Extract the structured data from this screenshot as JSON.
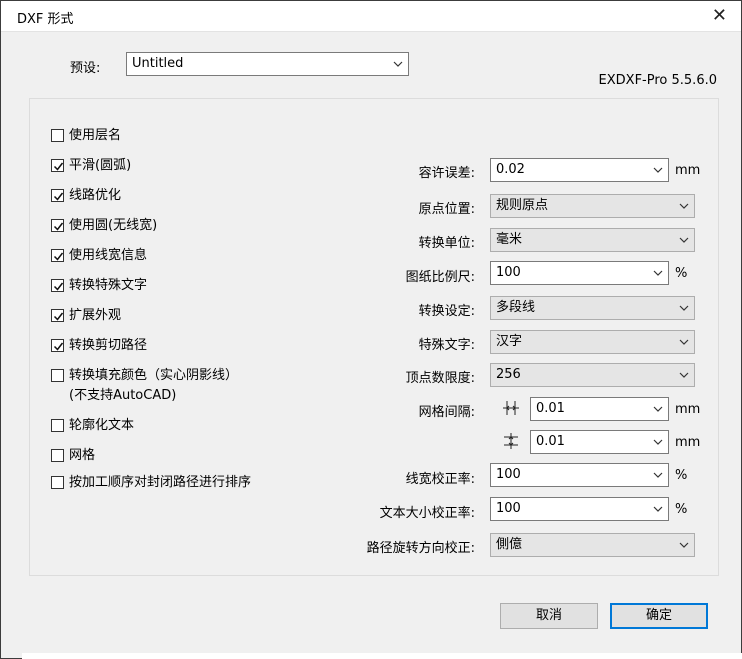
{
  "window": {
    "title": "DXF 形式",
    "close_glyph": "✕"
  },
  "preset": {
    "label": "预设:",
    "value": "Untitled"
  },
  "version": "EXDXF-Pro 5.5.6.0",
  "checkboxes": [
    {
      "label": "使用层名",
      "checked": false
    },
    {
      "label": "平滑(圆弧)",
      "checked": true
    },
    {
      "label": "线路优化",
      "checked": true
    },
    {
      "label": "使用圆(无线宽)",
      "checked": true
    },
    {
      "label": "使用线宽信息",
      "checked": true
    },
    {
      "label": "转换特殊文字",
      "checked": true
    },
    {
      "label": "扩展外观",
      "checked": true
    },
    {
      "label": "转换剪切路径",
      "checked": true
    },
    {
      "label": "转换填充颜色（实心阴影线）",
      "label2": "(不支持AutoCAD)",
      "checked": false
    },
    {
      "label": "轮廓化文本",
      "checked": false
    },
    {
      "label": "网格",
      "checked": false
    },
    {
      "label": "按加工顺序对封闭路径进行排序",
      "checked": false
    }
  ],
  "fields": {
    "tolerance": {
      "label": "容许误差:",
      "value": "0.02",
      "unit": "mm"
    },
    "origin": {
      "label": "原点位置:",
      "value": "规则原点"
    },
    "unit": {
      "label": "转换单位:",
      "value": "毫米"
    },
    "scale": {
      "label": "图纸比例尺:",
      "value": "100",
      "unit": "%"
    },
    "conversion": {
      "label": "转换设定:",
      "value": "多段线"
    },
    "special_text": {
      "label": "特殊文字:",
      "value": "汉字"
    },
    "vertex_limit": {
      "label": "顶点数限度:",
      "value": "256"
    },
    "grid_spacing": {
      "label": "网格间隔:",
      "h_value": "0.01",
      "v_value": "0.01",
      "unit": "mm"
    },
    "line_width_correction": {
      "label": "线宽校正率:",
      "value": "100",
      "unit": "%"
    },
    "text_size_correction": {
      "label": "文本大小校正率:",
      "value": "100",
      "unit": "%"
    },
    "path_rotation": {
      "label": "路径旋转方向校正:",
      "value": "側億"
    }
  },
  "buttons": {
    "cancel": "取消",
    "ok": "确定"
  },
  "colors": {
    "accent": "#0078d7",
    "dialog_bg": "#f0f0f0"
  }
}
